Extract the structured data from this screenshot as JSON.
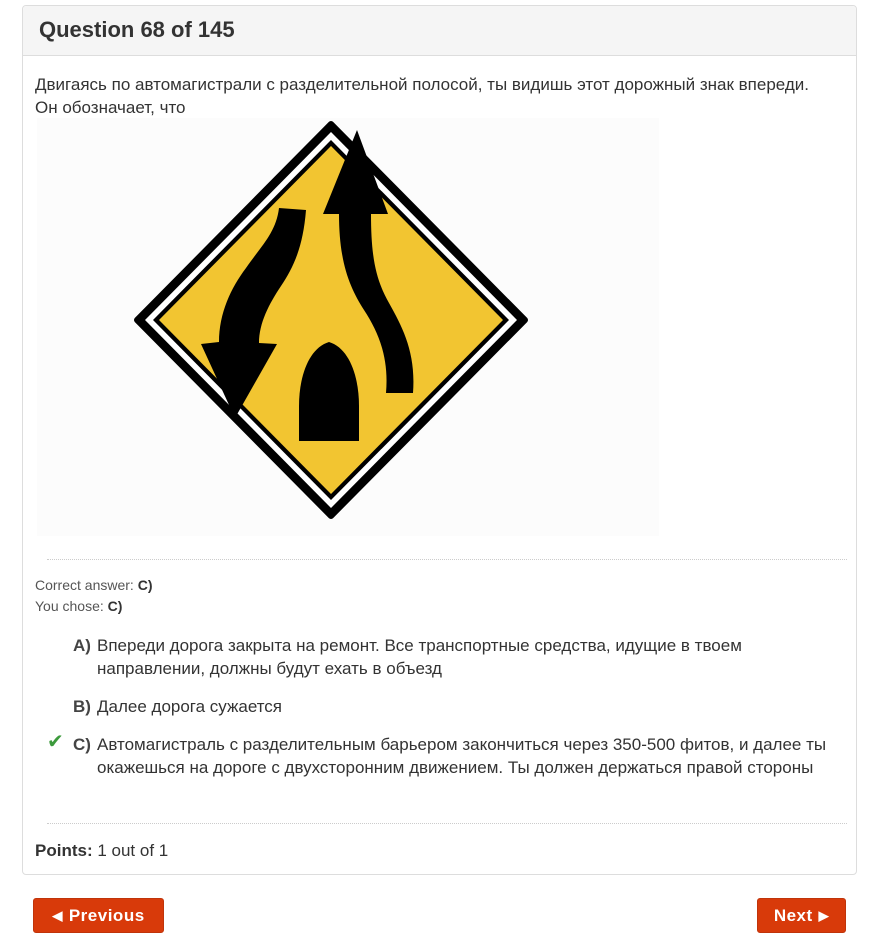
{
  "header": {
    "title": "Question 68 of 145"
  },
  "question": {
    "text": "Двигаясь по автомагистрали с разделительной полосой, ты видишь этот дорожный знак впереди. Он обозначает, что"
  },
  "sign": {
    "description_icon": "divided-highway-ends-sign",
    "colors": {
      "fill": "#f2c531",
      "border": "#000000"
    }
  },
  "result": {
    "correct_label": "Correct answer:",
    "correct_value": "C)",
    "chose_label": "You chose:",
    "chose_value": "C)"
  },
  "answers": [
    {
      "letter": "A)",
      "text": "Впереди дорога закрыта на ремонт. Все транспортные средства, идущие в твоем направлении, должны будут ехать в объезд",
      "correct": false
    },
    {
      "letter": "B)",
      "text": "Далее дорога сужается",
      "correct": false
    },
    {
      "letter": "C)",
      "text": "Автомагистраль с разделительным барьером закончиться через 350-500 фитов, и далее ты окажешься на дороге с двухсторонним движением. Ты должен держаться правой стороны",
      "correct": true
    }
  ],
  "points": {
    "label": "Points:",
    "value": "1 out of 1"
  },
  "nav": {
    "previous_label": "Previous",
    "next_label": "Next",
    "button_color": "#d83a0a"
  }
}
